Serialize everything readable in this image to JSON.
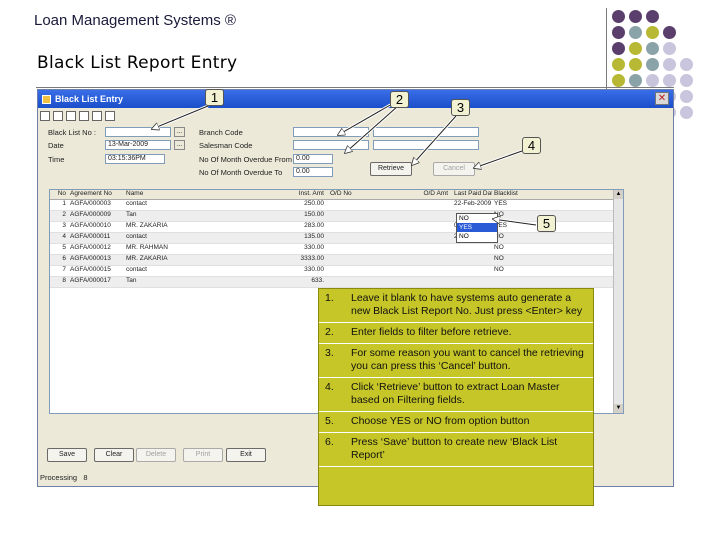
{
  "slide": {
    "title": "Loan Management Systems ®",
    "subtitle": "Black List Report Entry"
  },
  "decor": {
    "dot_colors": {
      "purple": "#5a3e6b",
      "teal": "#8aa3a8",
      "olive": "#b7b833",
      "lavender": "#c9c5dd"
    }
  },
  "window": {
    "title": "Black List Entry",
    "close_glyph": "✕",
    "labels": {
      "black_list_no": "Black List No :",
      "date": "Date",
      "time": "Time",
      "branch_code": "Branch Code",
      "salesman_code": "Salesman Code",
      "month_overdue_from": "No Of Month Overdue From",
      "month_overdue_to": "No Of Month Overdue To"
    },
    "fields": {
      "black_list_no": "",
      "date": "13-Mar-2009",
      "time": "03:15:36PM",
      "branch_code": "",
      "salesman_code": "",
      "month_overdue_from": "0.00",
      "month_overdue_to": "0.00"
    },
    "lookup_glyph": "...",
    "buttons": {
      "retrieve": "Retrieve",
      "cancel": "Cancel",
      "save": "Save",
      "clear": "Clear",
      "delete": "Delete",
      "print": "Print",
      "exit": "Exit"
    },
    "grid": {
      "columns": [
        "No",
        "Agreement No",
        "Name",
        "Inst. Amt",
        "O/D No",
        "O/D Amt",
        "Last Paid Date",
        "Blacklist"
      ],
      "rows": [
        [
          "1",
          "AGFA/000003",
          "contact",
          "250.00",
          "",
          "",
          "22-Feb-2009",
          "YES"
        ],
        [
          "2",
          "AGFA/000009",
          "Tan",
          "150.00",
          "",
          "",
          "",
          "NO"
        ],
        [
          "3",
          "AGFA/000010",
          "MR. ZAKARIA",
          "283.00",
          "",
          "",
          "09-Mar-2009",
          "YES"
        ],
        [
          "4",
          "AGFA/000011",
          "contact",
          "135.00",
          "",
          "",
          "26-Feb-2009",
          "NO"
        ],
        [
          "5",
          "AGFA/000012",
          "MR. RAHMAN",
          "330.00",
          "",
          "",
          "",
          "NO"
        ],
        [
          "6",
          "AGFA/000013",
          "MR. ZAKARIA",
          "3333.00",
          "",
          "",
          "",
          "NO"
        ],
        [
          "7",
          "AGFA/000015",
          "contact",
          "330.00",
          "",
          "",
          "",
          "NO"
        ],
        [
          "8",
          "AGFA/000017",
          "Tan",
          "633.",
          "",
          "",
          "",
          ""
        ]
      ],
      "dropdown_options": [
        "NO",
        "YES",
        "NO"
      ]
    },
    "status": {
      "label": "Processing",
      "value": "8"
    }
  },
  "callouts": [
    "1",
    "2",
    "3",
    "4",
    "5"
  ],
  "instructions": [
    {
      "num": "1.",
      "text": "Leave it blank to have systems auto generate a new Black List Report No. Just press <Enter> key"
    },
    {
      "num": "2.",
      "text": "Enter fields to filter before retrieve."
    },
    {
      "num": "3.",
      "text": "For some reason you want to cancel the retrieving you can press this ‘Cancel’ button."
    },
    {
      "num": "4.",
      "text": "Click ‘Retrieve’ button to extract Loan Master based on Filtering fields."
    },
    {
      "num": "5.",
      "text": "Choose YES or NO from option button"
    },
    {
      "num": "6.",
      "text": "Press ‘Save’ button to create new ‘Black List Report’"
    }
  ]
}
